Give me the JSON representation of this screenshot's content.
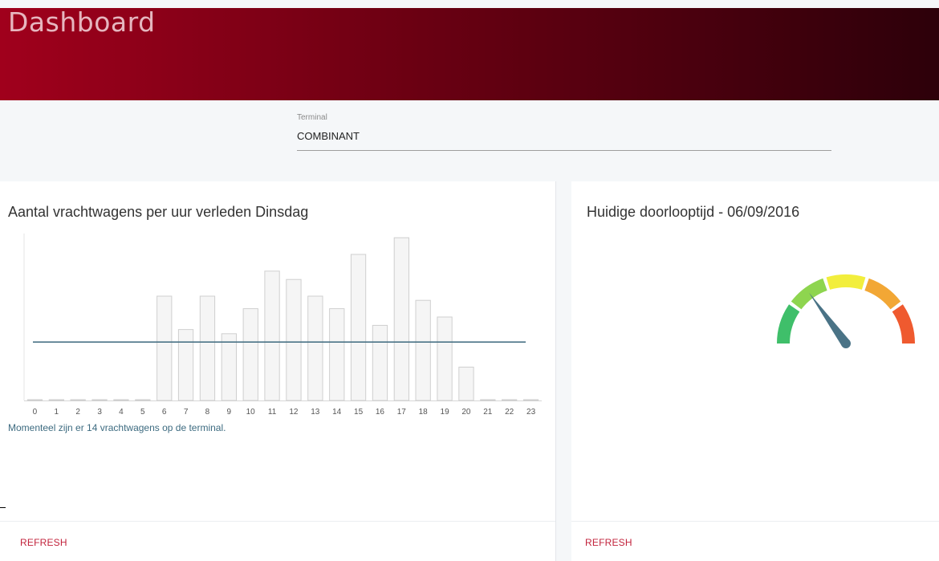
{
  "header": {
    "title": "Dashboard"
  },
  "filter": {
    "label": "Terminal",
    "value": "COMBINANT"
  },
  "left_card": {
    "title": "Aantal vrachtwagens per uur verleden Dinsdag",
    "status": "Momenteel zijn er 14 vrachtwagens op de terminal.",
    "refresh_label": "REFRESH"
  },
  "right_card": {
    "title": "Huidige doorlooptijd - 06/09/2016",
    "refresh_label": "REFRESH"
  },
  "colors": {
    "header_start": "#a0001c",
    "header_end": "#2d000a",
    "accent_text": "#c2233c",
    "reference_line": "#4a7386",
    "bar_fill": "#f5f5f5",
    "bar_stroke": "#cfcfcf",
    "gauge_needle": "#4a7386",
    "gauge_segments": [
      "#3fbf6a",
      "#8ed54f",
      "#f2ee3c",
      "#f2a735",
      "#ef5a2f"
    ]
  },
  "chart_data": {
    "type": "bar",
    "categories": [
      "0",
      "1",
      "2",
      "3",
      "4",
      "5",
      "6",
      "7",
      "8",
      "9",
      "10",
      "11",
      "12",
      "13",
      "14",
      "15",
      "16",
      "17",
      "18",
      "19",
      "20",
      "21",
      "22",
      "23"
    ],
    "values": [
      0,
      0,
      0,
      0,
      0,
      0,
      25,
      17,
      25,
      16,
      22,
      31,
      29,
      25,
      22,
      35,
      18,
      39,
      24,
      20,
      8,
      0,
      0,
      0
    ],
    "reference_line": 14,
    "ylim": [
      0,
      40
    ],
    "grid": false,
    "title": "Aantal vrachtwagens per uur verleden Dinsdag",
    "xlabel": "",
    "ylabel": ""
  },
  "gauge": {
    "type": "gauge",
    "segments": 5,
    "needle_fraction": 0.3
  }
}
